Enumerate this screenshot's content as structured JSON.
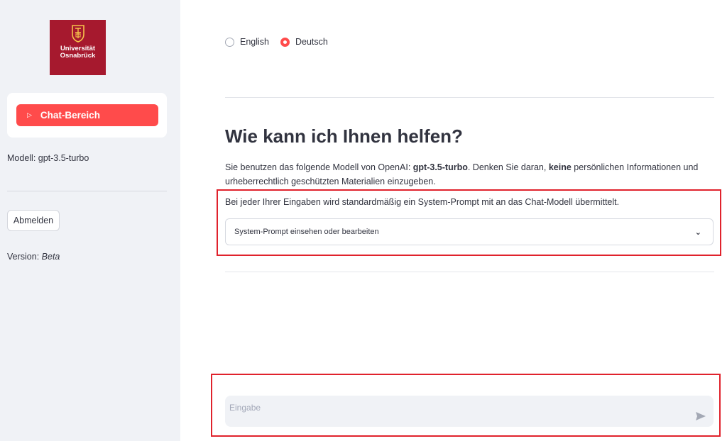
{
  "sidebar": {
    "logo": {
      "line1": "Universität",
      "line2": "Osnabrück"
    },
    "nav_button": {
      "label": "Chat-Bereich"
    },
    "model_text": "Modell: gpt-3.5-turbo",
    "logout_label": "Abmelden",
    "version_label": "Version:",
    "version_value": "Beta"
  },
  "language": {
    "options": [
      "English",
      "Deutsch"
    ],
    "selected": "Deutsch"
  },
  "main": {
    "title": "Wie kann ich Ihnen helfen?",
    "desc": {
      "p1": "Sie benutzen das folgende Modell von OpenAI: ",
      "model": "gpt-3.5-turbo",
      "p2": ". Denken Sie daran, ",
      "bold2": "keine",
      "p3": " persönlichen Informationen und urheberrechtlich geschützten Materialien einzugeben."
    },
    "system_info": "Bei jeder Ihrer Eingaben wird standardmäßig ein System-Prompt mit an das Chat-Modell übermittelt.",
    "expander_label": "System-Prompt einsehen oder bearbeiten"
  },
  "chat_input": {
    "placeholder": "Eingabe"
  },
  "colors": {
    "accent": "#ff4b4b",
    "highlight_border": "#e0222c",
    "logo_bg": "#a6192e",
    "sidebar_bg": "#f0f2f6"
  }
}
